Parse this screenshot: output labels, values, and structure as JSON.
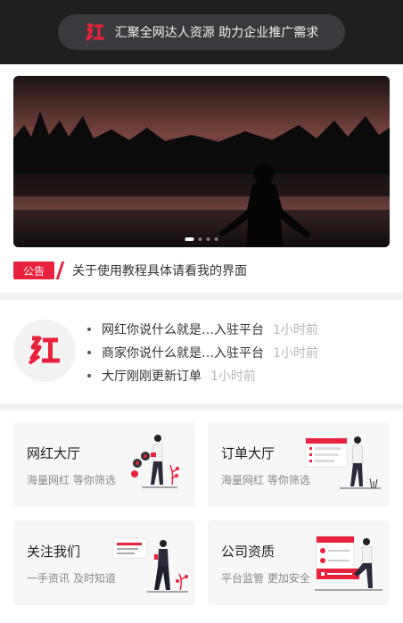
{
  "header": {
    "logo_icon": "hong-logo-icon",
    "slogan": "汇聚全网达人资源  助力企业推广需求"
  },
  "banner": {
    "image": "woman-silhouette-lake-sunset",
    "slide_count": 4,
    "active_slide": 1
  },
  "notice": {
    "tag": "公告",
    "text": "关于使用教程具体请看我的界面"
  },
  "feed": {
    "logo_icon": "hong-logo-icon",
    "items": [
      {
        "text": "网红你说什么就是…入驻平台",
        "time": "1小时前"
      },
      {
        "text": "商家你说什么就是…入驻平台",
        "time": "1小时前"
      },
      {
        "text": "大厅刚刚更新订单",
        "time": "1小时前"
      }
    ]
  },
  "cards": [
    {
      "title": "网红大厅",
      "subtitle": "海量网红   等你筛选",
      "icon": "influencer-illustration"
    },
    {
      "title": "订单大厅",
      "subtitle": "海量网红   等你筛选",
      "icon": "order-board-illustration"
    },
    {
      "title": "关注我们",
      "subtitle": "一手资讯   及时知道",
      "icon": "follow-us-illustration"
    },
    {
      "title": "公司资质",
      "subtitle": "平台监管   更加安全",
      "icon": "qualification-illustration"
    }
  ],
  "colors": {
    "accent": "#e8213d",
    "header_bg": "#1f1f22",
    "pill_bg": "#3a3a3e"
  }
}
